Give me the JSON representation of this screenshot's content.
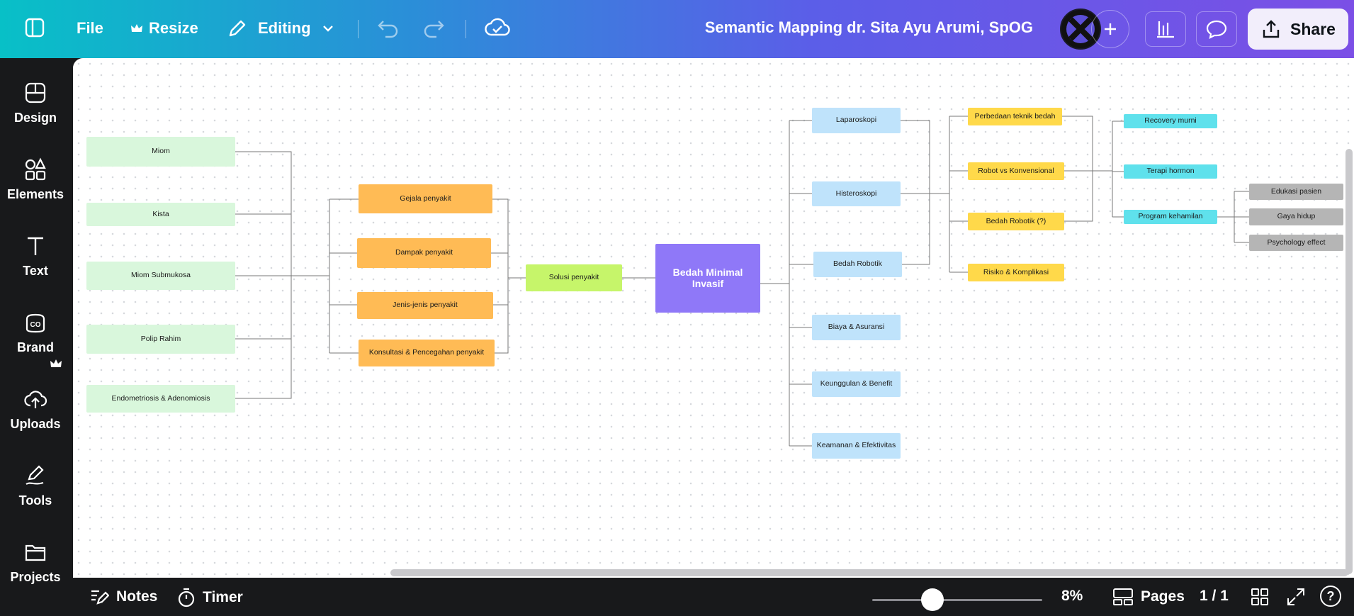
{
  "topbar": {
    "file_label": "File",
    "resize_label": "Resize",
    "editing_label": "Editing",
    "title": "Semantic Mapping dr. Sita Ayu Arumi, SpOG",
    "share_label": "Share"
  },
  "sidebar": {
    "items": [
      {
        "label": "Design"
      },
      {
        "label": "Elements"
      },
      {
        "label": "Text"
      },
      {
        "label": "Brand"
      },
      {
        "label": "Uploads"
      },
      {
        "label": "Tools"
      },
      {
        "label": "Projects"
      }
    ]
  },
  "mindmap": {
    "central": "Bedah Minimal Invasif",
    "solution": "Solusi penyakit",
    "left_categories": [
      "Gejala penyakit",
      "Dampak penyakit",
      "Jenis-jenis penyakit",
      "Konsultasi & Pencegahan penyakit"
    ],
    "diseases": [
      "Miom",
      "Kista",
      "Miom Submukosa",
      "Polip Rahim",
      "Endometriosis & Adenomiosis"
    ],
    "right_topics": [
      "Laparoskopi",
      "Histeroskopi",
      "Bedah Robotik",
      "Biaya & Asuransi",
      "Keunggulan & Benefit",
      "Keamanan & Efektivitas"
    ],
    "subtopics": [
      "Perbedaan teknik bedah",
      "Robot vs Konvensional",
      "Bedah Robotik (?)",
      "Risiko & Komplikasi"
    ],
    "subsub": [
      "Recovery murni",
      "Terapi hormon",
      "Program kehamilan"
    ],
    "leaves": [
      "Edukasi pasien",
      "Gaya hidup",
      "Psychology effect"
    ],
    "colors": {
      "green": "#d9f7dc",
      "orange": "#ffbb55",
      "lime": "#c6f56a",
      "purple": "#8f78f8",
      "blue": "#bfe3fb",
      "yellow": "#ffd94a",
      "cyan": "#5fe1ec",
      "gray": "#b5b5b5"
    }
  },
  "bottombar": {
    "notes_label": "Notes",
    "timer_label": "Timer",
    "zoom": "8%",
    "pages_label": "Pages",
    "page_count": "1 / 1",
    "help_label": "?"
  }
}
